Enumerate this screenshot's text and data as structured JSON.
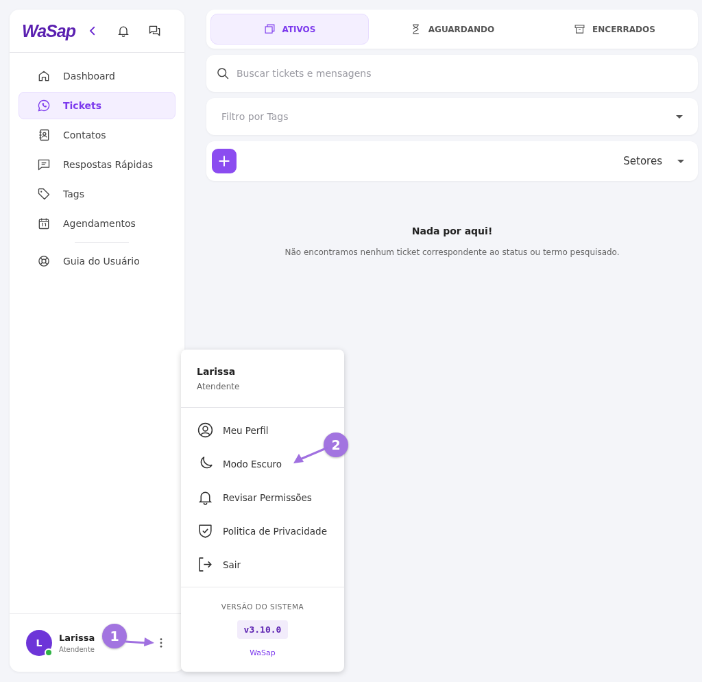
{
  "sidebar": {
    "logo": "WaSap",
    "items": [
      {
        "label": "Dashboard",
        "selected": false
      },
      {
        "label": "Tickets",
        "selected": true
      },
      {
        "label": "Contatos",
        "selected": false
      },
      {
        "label": "Respostas Rápidas",
        "selected": false
      },
      {
        "label": "Tags",
        "selected": false
      },
      {
        "label": "Agendamentos",
        "selected": false
      }
    ],
    "help_items": [
      {
        "label": "Guia do Usuário",
        "selected": false
      }
    ],
    "user": {
      "initial": "L",
      "name": "Larissa",
      "role": "Atendente",
      "online": true
    }
  },
  "tabs": [
    {
      "label": "ATIVOS",
      "selected": true
    },
    {
      "label": "AGUARDANDO",
      "selected": false
    },
    {
      "label": "ENCERRADOS",
      "selected": false
    }
  ],
  "search": {
    "placeholder": "Buscar tickets e mensagens"
  },
  "tag_filter": {
    "placeholder": "Filtro por Tags"
  },
  "sectors": {
    "label": "Setores"
  },
  "empty_state": {
    "title": "Nada por aqui!",
    "message": "Não encontramos nenhum ticket correspondente ao status ou termo pesquisado."
  },
  "user_menu": {
    "name": "Larissa",
    "role": "Atendente",
    "items": [
      {
        "label": "Meu Perfil"
      },
      {
        "label": "Modo Escuro"
      },
      {
        "label": "Revisar Permissões"
      },
      {
        "label": "Politica de Privacidade"
      },
      {
        "label": "Sair"
      }
    ],
    "version_label": "VERSÃO DO SISTEMA",
    "version": "v3.10.0",
    "brand": "WaSap"
  },
  "callouts": [
    {
      "number": "1"
    },
    {
      "number": "2"
    }
  ]
}
